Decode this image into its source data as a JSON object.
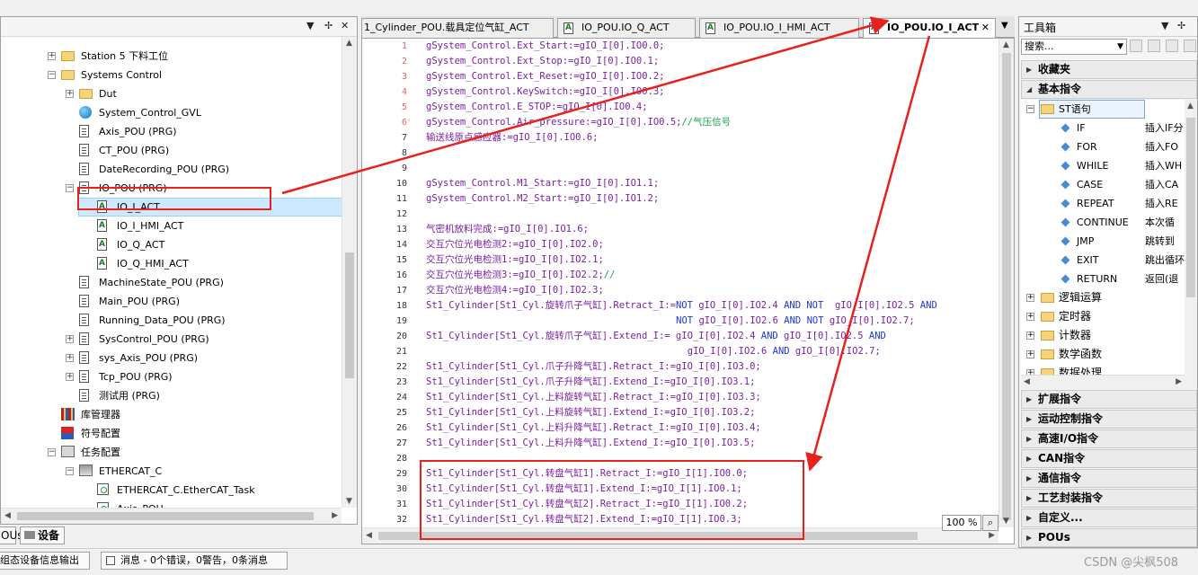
{
  "project_tree": {
    "items": [
      {
        "label": "Station 5 下料工位",
        "icon": "folder-icon",
        "indent": 1,
        "expander": "+"
      },
      {
        "label": "Systems Control",
        "icon": "folder-icon",
        "indent": 1,
        "expander": "−"
      },
      {
        "label": "Dut",
        "icon": "folder-icon",
        "indent": 2,
        "expander": "+"
      },
      {
        "label": "System_Control_GVL",
        "icon": "globe-icon",
        "indent": 2,
        "expander": ""
      },
      {
        "label": "Axis_POU (PRG)",
        "icon": "document-icon",
        "indent": 2,
        "expander": ""
      },
      {
        "label": "CT_POU (PRG)",
        "icon": "document-icon",
        "indent": 2,
        "expander": ""
      },
      {
        "label": "DateRecording_POU (PRG)",
        "icon": "document-icon",
        "indent": 2,
        "expander": ""
      },
      {
        "label": "IO_POU (PRG)",
        "icon": "document-icon",
        "indent": 2,
        "expander": "−"
      },
      {
        "label": "IO_I_ACT",
        "icon": "action-icon",
        "indent": 3,
        "expander": "",
        "selected": true
      },
      {
        "label": "IO_I_HMI_ACT",
        "icon": "action-icon",
        "indent": 3,
        "expander": ""
      },
      {
        "label": "IO_Q_ACT",
        "icon": "action-icon",
        "indent": 3,
        "expander": ""
      },
      {
        "label": "IO_Q_HMI_ACT",
        "icon": "action-icon",
        "indent": 3,
        "expander": ""
      },
      {
        "label": "MachineState_POU (PRG)",
        "icon": "document-icon",
        "indent": 2,
        "expander": ""
      },
      {
        "label": "Main_POU (PRG)",
        "icon": "document-icon",
        "indent": 2,
        "expander": ""
      },
      {
        "label": "Running_Data_POU (PRG)",
        "icon": "document-icon",
        "indent": 2,
        "expander": ""
      },
      {
        "label": "SysControl_POU (PRG)",
        "icon": "document-icon",
        "indent": 2,
        "expander": "+"
      },
      {
        "label": "sys_Axis_POU (PRG)",
        "icon": "document-icon",
        "indent": 2,
        "expander": "+"
      },
      {
        "label": "Tcp_POU (PRG)",
        "icon": "document-icon",
        "indent": 2,
        "expander": "+"
      },
      {
        "label": "测试用 (PRG)",
        "icon": "document-icon",
        "indent": 2,
        "expander": ""
      },
      {
        "label": "库管理器",
        "icon": "library-icon",
        "indent": 1,
        "expander": ""
      },
      {
        "label": "符号配置",
        "icon": "symbol-config-icon",
        "indent": 1,
        "expander": ""
      },
      {
        "label": "任务配置",
        "icon": "task-config-icon",
        "indent": 1,
        "expander": "−"
      },
      {
        "label": "ETHERCAT_C",
        "icon": "ethercat-icon",
        "indent": 2,
        "expander": "−"
      },
      {
        "label": "ETHERCAT_C.EtherCAT_Task",
        "icon": "task-icon",
        "indent": 3,
        "expander": ""
      },
      {
        "label": "Axis_POU",
        "icon": "task-icon",
        "indent": 3,
        "expander": ""
      }
    ]
  },
  "bottom_tabs": [
    {
      "label": "OUs"
    },
    {
      "label": "设备"
    }
  ],
  "status_bar": {
    "output_label": "组态设备信息输出",
    "messages_label": "消息 - 0个错误，0警告，0条消息"
  },
  "editor": {
    "tabs": [
      {
        "label": "1_Cylinder_POU.载具定位气缸_ACT",
        "active": false,
        "closable": false
      },
      {
        "label": "IO_POU.IO_Q_ACT",
        "active": false,
        "closable": false
      },
      {
        "label": "IO_POU.IO_I_HMI_ACT",
        "active": false,
        "closable": false
      },
      {
        "label": "IO_POU.IO_I_ACT",
        "active": true,
        "closable": true
      }
    ],
    "zoom": "100 %",
    "lines": [
      {
        "n": "1",
        "html": "gSystem_Control.Ext_Start:=gIO_I[0].IO0.0;",
        "marked": true
      },
      {
        "n": "2",
        "html": "gSystem_Control.Ext_Stop:=gIO_I[0].IO0.1;",
        "marked": true
      },
      {
        "n": "3",
        "html": "gSystem_Control.Ext_Reset:=gIO_I[0].IO0.2;",
        "marked": true
      },
      {
        "n": "4",
        "html": "gSystem_Control.KeySwitch:=gIO_I[0].IO0.3;",
        "marked": true
      },
      {
        "n": "5",
        "html": "gSystem_Control.E_STOP:=gIO_I[0].IO0.4;",
        "marked": true
      },
      {
        "n": "6",
        "html": "gSystem_Control.Air_pressure:=gIO_I[0].IO0.5;<span class=\"cm\">//气压信号</span>",
        "marked": true
      },
      {
        "n": "7",
        "html": "输送线原点感应器:=gIO_I[0].IO0.6;",
        "marked": false
      },
      {
        "n": "8",
        "html": "",
        "marked": false
      },
      {
        "n": "9",
        "html": "",
        "marked": false
      },
      {
        "n": "10",
        "html": "gSystem_Control.M1_Start:=gIO_I[0].IO1.1;",
        "marked": false
      },
      {
        "n": "11",
        "html": "gSystem_Control.M2_Start:=gIO_I[0].IO1.2;",
        "marked": false
      },
      {
        "n": "12",
        "html": "",
        "marked": false
      },
      {
        "n": "13",
        "html": "气密机放料完成:=gIO_I[0].IO1.6;",
        "marked": false
      },
      {
        "n": "14",
        "html": "交互穴位光电检测2:=gIO_I[0].IO2.0;",
        "marked": false
      },
      {
        "n": "15",
        "html": "交互穴位光电检测1:=gIO_I[0].IO2.1;",
        "marked": false
      },
      {
        "n": "16",
        "html": "交互穴位光电检测3:=gIO_I[0].IO2.2;<span class=\"cm\">//</span>",
        "marked": false
      },
      {
        "n": "17",
        "html": "交互穴位光电检测4:=gIO_I[0].IO2.3;",
        "marked": false
      },
      {
        "n": "18",
        "html": "St1_Cylinder[St1_Cyl.旋转爪子气缸].Retract_I:=<span class=\"kw\">NOT</span> gIO_I[0].IO2.4 <span class=\"kw\">AND NOT</span>  gIO_I[0].IO2.5 <span class=\"kw\">AND</span>",
        "marked": false
      },
      {
        "n": "19",
        "html": "                                            <span class=\"kw\">NOT</span> gIO_I[0].IO2.6 <span class=\"kw\">AND NOT</span> gIO_I[0].IO2.7;",
        "marked": false
      },
      {
        "n": "20",
        "html": "St1_Cylinder[St1_Cyl.旋转爪子气缸].Extend_I:= gIO_I[0].IO2.4 <span class=\"kw\">AND</span> gIO_I[0].IO2.5 <span class=\"kw\">AND</span>",
        "marked": false
      },
      {
        "n": "21",
        "html": "                                              gIO_I[0].IO2.6 <span class=\"kw\">AND</span> gIO_I[0].IO2.7;",
        "marked": false
      },
      {
        "n": "22",
        "html": "St1_Cylinder[St1_Cyl.爪子升降气缸].Retract_I:=gIO_I[0].IO3.0;",
        "marked": false
      },
      {
        "n": "23",
        "html": "St1_Cylinder[St1_Cyl.爪子升降气缸].Extend_I:=gIO_I[0].IO3.1;",
        "marked": false
      },
      {
        "n": "24",
        "html": "St1_Cylinder[St1_Cyl.上料旋转气缸].Retract_I:=gIO_I[0].IO3.3;",
        "marked": false
      },
      {
        "n": "25",
        "html": "St1_Cylinder[St1_Cyl.上料旋转气缸].Extend_I:=gIO_I[0].IO3.2;",
        "marked": false
      },
      {
        "n": "26",
        "html": "St1_Cylinder[St1_Cyl.上料升降气缸].Retract_I:=gIO_I[0].IO3.4;",
        "marked": false
      },
      {
        "n": "27",
        "html": "St1_Cylinder[St1_Cyl.上料升降气缸].Extend_I:=gIO_I[0].IO3.5;",
        "marked": false
      },
      {
        "n": "28",
        "html": "",
        "marked": false
      },
      {
        "n": "29",
        "html": "St1_Cylinder[St1_Cyl.转盘气缸1].Retract_I:=gIO_I[1].IO0.0;",
        "marked": false
      },
      {
        "n": "30",
        "html": "St1_Cylinder[St1_Cyl.转盘气缸1].Extend_I:=gIO_I[1].IO0.1;",
        "marked": false
      },
      {
        "n": "31",
        "html": "St1_Cylinder[St1_Cyl.转盘气缸2].Retract_I:=gIO_I[1].IO0.2;",
        "marked": false
      },
      {
        "n": "32",
        "html": "St1_Cylinder[St1_Cyl.转盘气缸2].Extend_I:=gIO_I[1].IO0.3;",
        "marked": false
      },
      {
        "n": "33",
        "html": "",
        "marked": false
      }
    ]
  },
  "toolbox": {
    "title": "工具箱",
    "search_placeholder": "搜索...",
    "categories_top": [
      {
        "label": "收藏夹",
        "open": false
      },
      {
        "label": "基本指令",
        "open": true
      }
    ],
    "st_group": "ST语句",
    "st_items": [
      {
        "name": "IF",
        "desc": "插入IF分"
      },
      {
        "name": "FOR",
        "desc": "插入FO"
      },
      {
        "name": "WHILE",
        "desc": "插入WH"
      },
      {
        "name": "CASE",
        "desc": "插入CA"
      },
      {
        "name": "REPEAT",
        "desc": "插入RE"
      },
      {
        "name": "CONTINUE",
        "desc": "本次循"
      },
      {
        "name": "JMP",
        "desc": "跳转到"
      },
      {
        "name": "EXIT",
        "desc": "跳出循环"
      },
      {
        "name": "RETURN",
        "desc": "返回(退"
      }
    ],
    "sub_groups": [
      "逻辑运算",
      "定时器",
      "计数器",
      "数学函数",
      "数据处理"
    ],
    "categories_bottom": [
      {
        "label": "扩展指令"
      },
      {
        "label": "运动控制指令"
      },
      {
        "label": "高速I/O指令"
      },
      {
        "label": "CAN指令"
      },
      {
        "label": "通信指令"
      },
      {
        "label": "工艺封装指令"
      },
      {
        "label": "自定义..."
      },
      {
        "label": "POUs"
      }
    ]
  },
  "watermark": "CSDN @尖枫508",
  "colors": {
    "annotation_red": "#e8201e",
    "selection": "#cde8ff",
    "keyword": "#1a37d6",
    "identifier": "#7a1fa2",
    "comment": "#16a34a"
  }
}
